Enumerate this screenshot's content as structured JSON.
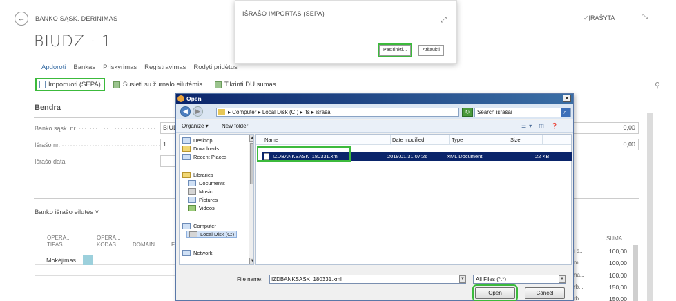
{
  "page": {
    "caption": "BANKO SĄSK. DERINIMAS",
    "title": "BIUDZ · 1",
    "saved_status": "✓ĮRAŠYTA",
    "back_icon": "back-arrow-icon",
    "collapse_icon": "collapse-icon"
  },
  "menu_tabs": [
    "Apdoroti",
    "Bankas",
    "Priskyrimas",
    "Registravimas",
    "Rodyti pridėtus"
  ],
  "actions": {
    "import": "Importuoti (SEPA)",
    "link": "Susieti su žurnalo eilutėmis",
    "check": "Tikrinti DU sumas"
  },
  "general": {
    "section_title": "Bendra",
    "fields": [
      {
        "label": "Banko sąsk. nr.",
        "value": "BIUD"
      },
      {
        "label": "Išrašo nr.",
        "value": "1"
      },
      {
        "label": "Išrašo data",
        "value": ""
      }
    ],
    "right_values": [
      "0,00",
      "0,00"
    ]
  },
  "lines": {
    "title": "Banko išrašo eilutės ˅",
    "headers": [
      "OPERA... TIPAS",
      "OPERA... KODAS",
      "DOMAIN",
      "F"
    ],
    "row1_type": "Mokėjimas",
    "suma_header": "SUMA",
    "suma_values": [
      "100,00",
      "100,00",
      "100,00",
      "150,00",
      "150,00"
    ],
    "suma_fragments": [
      "j š...",
      "m...",
      "ha...",
      "rb...",
      "rb..."
    ]
  },
  "sepa_dialog": {
    "title": "IŠRAŠO IMPORTAS (SEPA)",
    "select_btn": "Pasirinkti...",
    "cancel_btn": "Atšaukti"
  },
  "open_dialog": {
    "title": "Open",
    "breadcrumb": "▸ Computer ▸ Local Disk (C:) ▸ its ▸ išrašai",
    "search_placeholder": "Search išrašai",
    "organize": "Organize ▾",
    "new_folder": "New folder",
    "nav": {
      "desktop": "Desktop",
      "downloads": "Downloads",
      "recent": "Recent Places",
      "libraries": "Libraries",
      "documents": "Documents",
      "music": "Music",
      "pictures": "Pictures",
      "videos": "Videos",
      "computer": "Computer",
      "local_disk": "Local Disk (C:)",
      "network": "Network"
    },
    "columns": {
      "name": "Name",
      "date": "Date modified",
      "type": "Type",
      "size": "Size"
    },
    "file": {
      "name": "IZDBANKSASK_180331.xml",
      "date": "2019.01.31 07:26",
      "type": "XML Document",
      "size": "22 KB"
    },
    "file_name_label": "File name:",
    "file_name_value": "IZDBANKSASK_180331.xml",
    "filter": "All Files (*.*)",
    "open_btn": "Open",
    "cancel_btn": "Cancel"
  },
  "colors": {
    "highlight": "#3cba3c",
    "selection": "#0a246a",
    "titlebar": "#0a246a"
  }
}
